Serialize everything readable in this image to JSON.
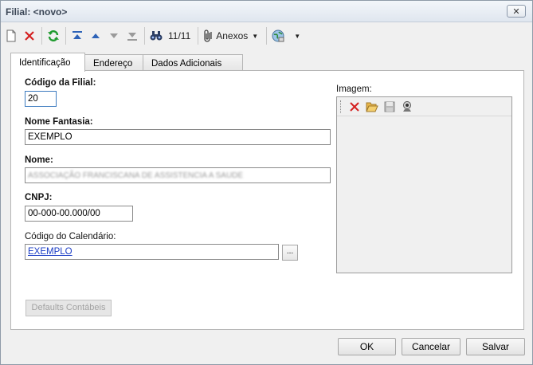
{
  "window": {
    "title": "Filial: <novo>",
    "close_label": "✕"
  },
  "toolbar": {
    "record_counter": "11/11",
    "attachments_label": "Anexos"
  },
  "tabs": [
    {
      "label": "Identificação",
      "active": true
    },
    {
      "label": "Endereço",
      "active": false
    },
    {
      "label": "Dados Adicionais",
      "active": false
    }
  ],
  "form": {
    "codigo_filial": {
      "label": "Código da Filial:",
      "value": "20"
    },
    "nome_fantasia": {
      "label": "Nome Fantasia:",
      "value": "EXEMPLO"
    },
    "nome": {
      "label": "Nome:",
      "value": "ASSOCIAÇÃO FRANCISCANA DE ASSISTENCIA A SAUDE"
    },
    "cnpj": {
      "label": "CNPJ:",
      "value": "00-000-00.000/00"
    },
    "codigo_calendario": {
      "label": "Código do Calendário:",
      "value": "EXEMPLO",
      "browse_label": "..."
    },
    "defaults_button": "Defaults Contábeis"
  },
  "image_panel": {
    "label": "Imagem:"
  },
  "footer": {
    "ok": "OK",
    "cancel": "Cancelar",
    "save": "Salvar"
  },
  "colors": {
    "accent": "#3d7bbf",
    "link": "#1a3cc5",
    "delete_red": "#d42020",
    "refresh_green": "#1e9a2e"
  }
}
